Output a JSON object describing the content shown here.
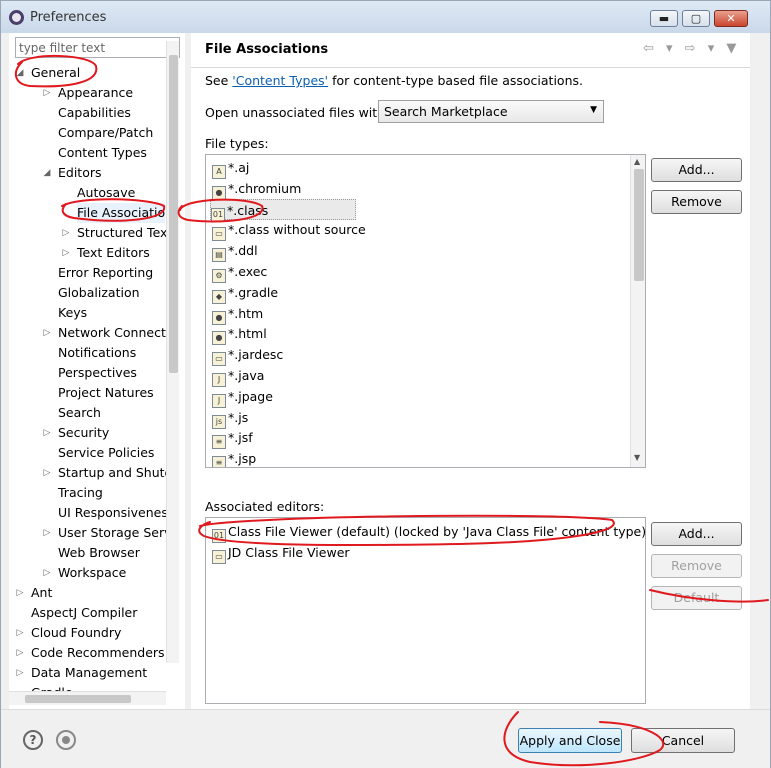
{
  "window": {
    "title": "Preferences",
    "minimize": "▬",
    "maximize": "▢",
    "close": "✕"
  },
  "filter": {
    "placeholder": "type filter text"
  },
  "tree": [
    {
      "label": "General",
      "level": 0,
      "twisty": "◢"
    },
    {
      "label": "Appearance",
      "level": 1,
      "twisty": "▷"
    },
    {
      "label": "Capabilities",
      "level": 1,
      "twisty": ""
    },
    {
      "label": "Compare/Patch",
      "level": 1,
      "twisty": ""
    },
    {
      "label": "Content Types",
      "level": 1,
      "twisty": ""
    },
    {
      "label": "Editors",
      "level": 1,
      "twisty": "◢"
    },
    {
      "label": "Autosave",
      "level": 2,
      "twisty": ""
    },
    {
      "label": "File Associatio",
      "level": 2,
      "twisty": "",
      "selected": true
    },
    {
      "label": "Structured Text",
      "level": 2,
      "twisty": "▷"
    },
    {
      "label": "Text Editors",
      "level": 2,
      "twisty": "▷"
    },
    {
      "label": "Error Reporting",
      "level": 1,
      "twisty": ""
    },
    {
      "label": "Globalization",
      "level": 1,
      "twisty": ""
    },
    {
      "label": "Keys",
      "level": 1,
      "twisty": ""
    },
    {
      "label": "Network Connectio",
      "level": 1,
      "twisty": "▷"
    },
    {
      "label": "Notifications",
      "level": 1,
      "twisty": ""
    },
    {
      "label": "Perspectives",
      "level": 1,
      "twisty": ""
    },
    {
      "label": "Project Natures",
      "level": 1,
      "twisty": ""
    },
    {
      "label": "Search",
      "level": 1,
      "twisty": ""
    },
    {
      "label": "Security",
      "level": 1,
      "twisty": "▷"
    },
    {
      "label": "Service Policies",
      "level": 1,
      "twisty": ""
    },
    {
      "label": "Startup and Shutd",
      "level": 1,
      "twisty": "▷"
    },
    {
      "label": "Tracing",
      "level": 1,
      "twisty": ""
    },
    {
      "label": "UI Responsiveness",
      "level": 1,
      "twisty": ""
    },
    {
      "label": "User Storage Serv",
      "level": 1,
      "twisty": "▷"
    },
    {
      "label": "Web Browser",
      "level": 1,
      "twisty": ""
    },
    {
      "label": "Workspace",
      "level": 1,
      "twisty": "▷"
    },
    {
      "label": "Ant",
      "level": 0,
      "twisty": "▷"
    },
    {
      "label": "AspectJ Compiler",
      "level": 0,
      "twisty": ""
    },
    {
      "label": "Cloud Foundry",
      "level": 0,
      "twisty": "▷"
    },
    {
      "label": "Code Recommenders",
      "level": 0,
      "twisty": "▷"
    },
    {
      "label": "Data Management",
      "level": 0,
      "twisty": "▷"
    },
    {
      "label": "Gradle",
      "level": 0,
      "twisty": ""
    }
  ],
  "page": {
    "title": "File Associations",
    "nav": "⇦ ▾ ⇨ ▾ ▼",
    "see_prefix": "See ",
    "see_link": "'Content Types'",
    "see_suffix": " for content-type based file associations.",
    "open_label": "Open unassociated files with:",
    "open_value": "Search Marketplace",
    "filetypes_label": "File types:",
    "filetypes": [
      {
        "label": "*.aj",
        "icon": "A"
      },
      {
        "label": "*.chromium",
        "icon": "●"
      },
      {
        "label": "*.class",
        "icon": "01",
        "selected": true
      },
      {
        "label": "*.class without source",
        "icon": "▭"
      },
      {
        "label": "*.ddl",
        "icon": "▤"
      },
      {
        "label": "*.exec",
        "icon": "⚙"
      },
      {
        "label": "*.gradle",
        "icon": "◆"
      },
      {
        "label": "*.htm",
        "icon": "●"
      },
      {
        "label": "*.html",
        "icon": "●"
      },
      {
        "label": "*.jardesc",
        "icon": "▭"
      },
      {
        "label": "*.java",
        "icon": "J"
      },
      {
        "label": "*.jpage",
        "icon": "J"
      },
      {
        "label": "*.js",
        "icon": "js"
      },
      {
        "label": "*.jsf",
        "icon": "≡"
      },
      {
        "label": "*.jsp",
        "icon": "≡"
      }
    ],
    "ft_add": "Add...",
    "ft_remove": "Remove",
    "assoc_label": "Associated editors:",
    "editors": [
      {
        "label": "Class File Viewer (default) (locked by 'Java Class File' content type)",
        "icon": "01"
      },
      {
        "label": "JD Class File Viewer",
        "icon": "▭"
      }
    ],
    "ae_add": "Add...",
    "ae_remove": "Remove",
    "ae_default": "Default"
  },
  "bottom": {
    "help": "?",
    "apply_close": "Apply and Close",
    "cancel": "Cancel"
  },
  "colors": {
    "annotation": "#e0191e",
    "link": "#0b5fb1"
  }
}
